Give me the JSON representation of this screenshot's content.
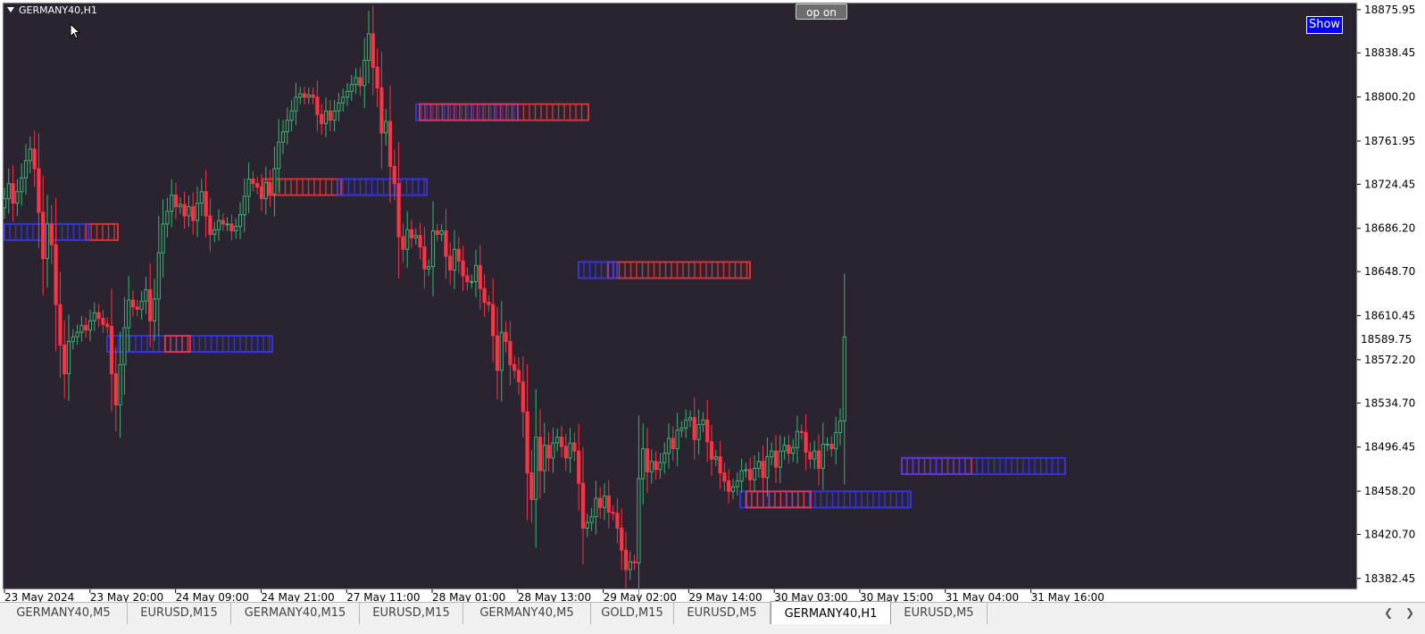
{
  "window": {
    "symbol_title": "GERMANY40,H1",
    "op_button_label": "op on",
    "show_button_label": "Show"
  },
  "colors": {
    "background": "#292430",
    "frame": "#d9d9d9",
    "bull": "#3cb371",
    "bear": "#ff3344",
    "zone_red": "#ff3b3b",
    "zone_blue": "#3b3bff",
    "current_price_box": "#ffffff"
  },
  "price_axis": {
    "labels": [
      "18875.95",
      "18838.45",
      "18800.20",
      "18761.95",
      "18724.45",
      "18686.20",
      "18648.70",
      "18610.45",
      "18572.20",
      "18534.70",
      "18496.45",
      "18458.20",
      "18420.70",
      "18382.45"
    ],
    "current_price": "18589.75"
  },
  "time_axis": {
    "labels": [
      "23 May 2024",
      "23 May 20:00",
      "24 May 09:00",
      "24 May 21:00",
      "27 May 11:00",
      "28 May 01:00",
      "28 May 13:00",
      "29 May 02:00",
      "29 May 14:00",
      "30 May 03:00",
      "30 May 15:00",
      "31 May 04:00",
      "31 May 16:00"
    ]
  },
  "tabs": [
    {
      "label": "GERMANY40,M5",
      "active": false
    },
    {
      "label": "EURUSD,M15",
      "active": false
    },
    {
      "label": "GERMANY40,M15",
      "active": false
    },
    {
      "label": "EURUSD,M15",
      "active": false
    },
    {
      "label": "GERMANY40,M5",
      "active": false
    },
    {
      "label": "GOLD,M15",
      "active": false
    },
    {
      "label": "EURUSD,M5",
      "active": false
    },
    {
      "label": "GERMANY40,H1",
      "active": true
    },
    {
      "label": "EURUSD,M5",
      "active": false
    }
  ],
  "chart_data": {
    "type": "candlestick",
    "symbol": "GERMANY40",
    "timeframe": "H1",
    "ylim": [
      18373,
      18882
    ],
    "closes": [
      18712,
      18725,
      18708,
      18718,
      18730,
      18745,
      18755,
      18738,
      18700,
      18660,
      18690,
      18672,
      18620,
      18585,
      18560,
      18588,
      18592,
      18596,
      18602,
      18598,
      18606,
      18613,
      18608,
      18603,
      18601,
      18560,
      18533,
      18568,
      18600,
      18624,
      18618,
      18616,
      18623,
      18633,
      18606,
      18625,
      18665,
      18690,
      18701,
      18715,
      18705,
      18707,
      18697,
      18705,
      18693,
      18708,
      18718,
      18697,
      18681,
      18685,
      18693,
      18690,
      18690,
      18684,
      18688,
      18698,
      18714,
      18729,
      18725,
      18722,
      18712,
      18726,
      18716,
      18738,
      18761,
      18770,
      18780,
      18788,
      18800,
      18803,
      18800,
      18802,
      18800,
      18785,
      18777,
      18788,
      18780,
      18788,
      18795,
      18800,
      18805,
      18811,
      18817,
      18810,
      18832,
      18855,
      18826,
      18808,
      18769,
      18779,
      18740,
      18725,
      18679,
      18668,
      18685,
      18678,
      18680,
      18670,
      18651,
      18653,
      18684,
      18681,
      18684,
      18662,
      18650,
      18668,
      18658,
      18645,
      18640,
      18640,
      18654,
      18634,
      18622,
      18620,
      18593,
      18563,
      18596,
      18588,
      18568,
      18563,
      18553,
      18527,
      18474,
      18451,
      18505,
      18476,
      18498,
      18487,
      18500,
      18505,
      18497,
      18487,
      18500,
      18493,
      18465,
      18426,
      18431,
      18436,
      18452,
      18444,
      18454,
      18440,
      18439,
      18426,
      18407,
      18390,
      18397,
      18396,
      18469,
      18495,
      18475,
      18484,
      18477,
      18483,
      18491,
      18504,
      18495,
      18511,
      18513,
      18520,
      18522,
      18503,
      18516,
      18520,
      18501,
      18486,
      18488,
      18474,
      18467,
      18458,
      18462,
      18467,
      18476,
      18477,
      18468,
      18478,
      18484,
      18470,
      18488,
      18493,
      18479,
      18493,
      18498,
      18491,
      18496,
      18510,
      18509,
      18492,
      18486,
      18493,
      18478,
      18499,
      18499,
      18495,
      18509,
      18519,
      18592
    ],
    "zones": [
      {
        "color": "red",
        "from": 96,
        "to": 132,
        "low": 18676,
        "high": 18690
      },
      {
        "color": "blue",
        "from": 5,
        "to": 99,
        "low": 18676,
        "high": 18690
      },
      {
        "color": "blue",
        "from": 120,
        "to": 305,
        "low": 18579,
        "high": 18593
      },
      {
        "color": "red",
        "from": 185,
        "to": 213,
        "low": 18579,
        "high": 18593
      },
      {
        "color": "red",
        "from": 294,
        "to": 382,
        "low": 18715,
        "high": 18729
      },
      {
        "color": "blue",
        "from": 378,
        "to": 478,
        "low": 18715,
        "high": 18729
      },
      {
        "color": "blue",
        "from": 466,
        "to": 580,
        "low": 18780,
        "high": 18794
      },
      {
        "color": "red",
        "from": 470,
        "to": 659,
        "low": 18780,
        "high": 18794
      },
      {
        "color": "red",
        "from": 681,
        "to": 840,
        "low": 18643,
        "high": 18657
      },
      {
        "color": "blue",
        "from": 648,
        "to": 691,
        "low": 18643,
        "high": 18657
      },
      {
        "color": "blue",
        "from": 829,
        "to": 1020,
        "low": 18444,
        "high": 18458
      },
      {
        "color": "red",
        "from": 836,
        "to": 908,
        "low": 18444,
        "high": 18458
      },
      {
        "color": "red",
        "from": 1010,
        "to": 1088,
        "low": 18473,
        "high": 18487
      },
      {
        "color": "blue",
        "from": 1010,
        "to": 1193,
        "low": 18473,
        "high": 18487
      }
    ]
  }
}
